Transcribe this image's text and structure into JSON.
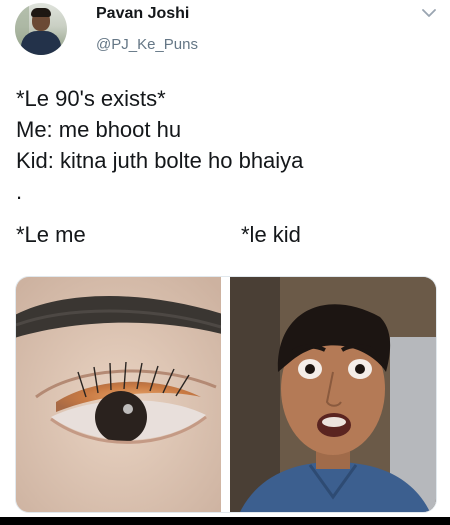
{
  "user": {
    "display_name": "Pavan Joshi",
    "handle": "@PJ_Ke_Puns",
    "avatar_icon": "profile-photo"
  },
  "tweet": {
    "lines": [
      "*Le 90's exists*",
      "Me: me bhoot hu",
      "Kid: kitna juth bolte ho bhaiya",
      "."
    ],
    "caption_left": "*Le me",
    "caption_right": "*le kid"
  },
  "media": {
    "images": [
      "closeup-eye-photo",
      "surprised-kid-photo"
    ]
  },
  "icons": {
    "more": "chevron-down-icon"
  },
  "colors": {
    "text": "#14171a",
    "secondary": "#657786",
    "border": "#e1e8ed"
  }
}
